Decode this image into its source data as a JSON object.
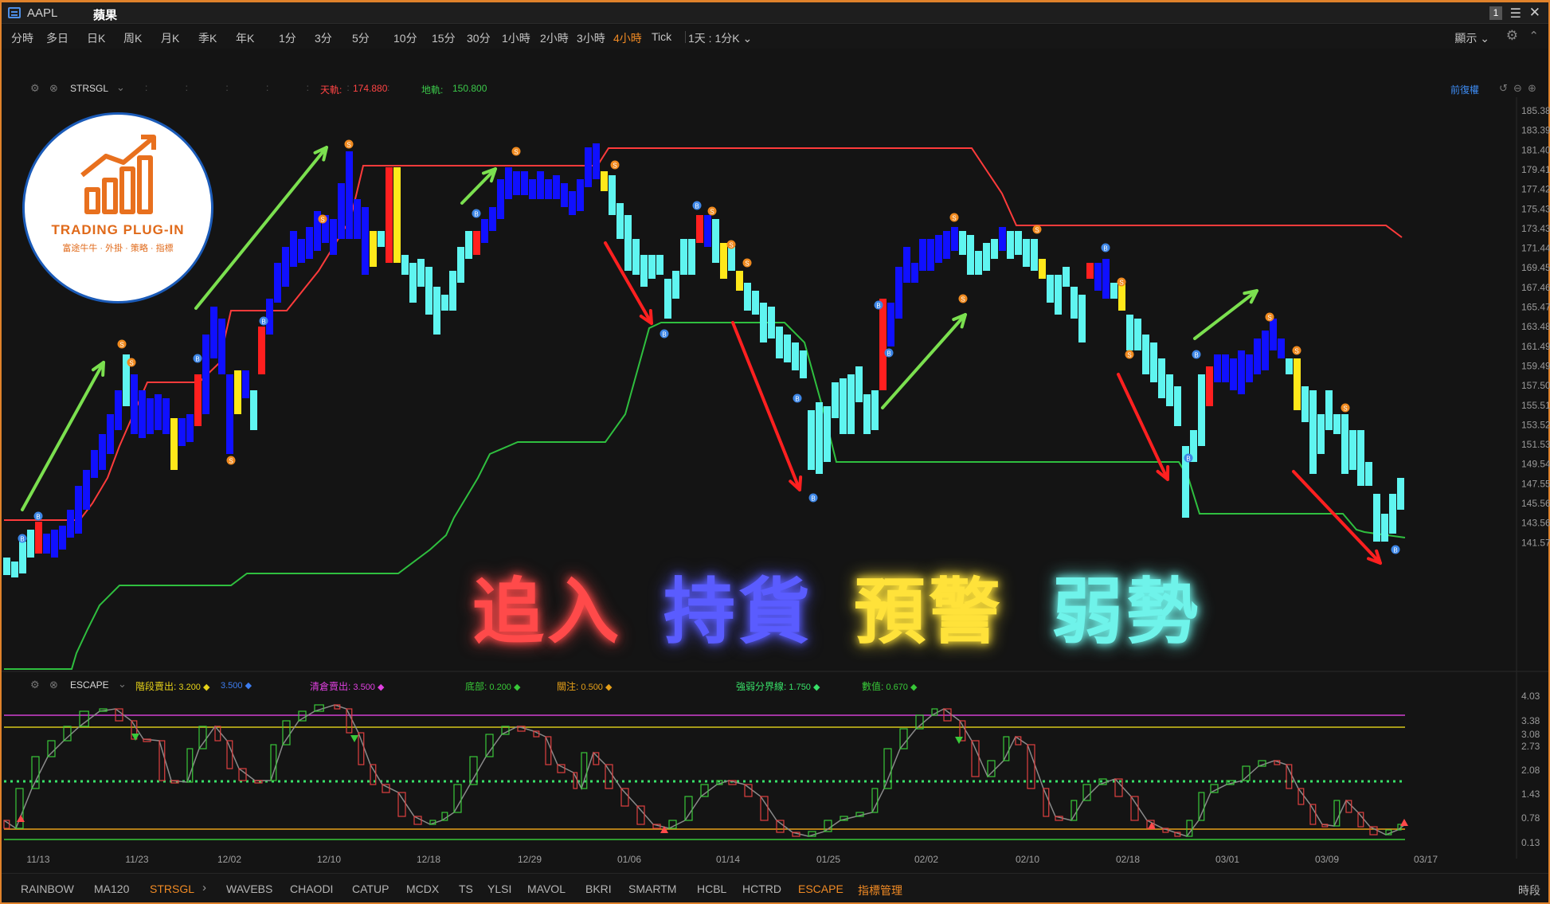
{
  "window": {
    "symbol": "AAPL",
    "name": "蘋果",
    "window_number": "1"
  },
  "periods": {
    "items": [
      "分時",
      "多日",
      "日K",
      "周K",
      "月K",
      "季K",
      "年K",
      "1分",
      "3分",
      "5分",
      "10分",
      "15分",
      "30分",
      "1小時",
      "2小時",
      "3小時",
      "4小時",
      "Tick"
    ],
    "active": "4小時",
    "aggregation": "1天 : 1分K",
    "display_label": "顯示"
  },
  "strsgl": {
    "name": "STRSGL",
    "upper_label": "天軌:",
    "upper_value": "174.880",
    "lower_label": "地軌:",
    "lower_value": "150.800",
    "adjust_label": "前復權",
    "y_ticks": [
      "185.386",
      "183.395",
      "181.404",
      "179.412",
      "177.421",
      "175.430",
      "173.438",
      "171.447",
      "169.456",
      "167.464",
      "165.473",
      "163.482",
      "161.490",
      "159.499",
      "157.508",
      "155.516",
      "153.525",
      "151.534",
      "149.542",
      "147.551",
      "145.560",
      "143.568",
      "141.577"
    ],
    "colors": {
      "upper": "#ff3b3b",
      "lower": "#2fbf3f",
      "chase": "#ff1f1f",
      "hold": "#1010ff",
      "warn": "#ffe81a",
      "weak": "#5ff5f0"
    }
  },
  "escape": {
    "name": "ESCAPE",
    "params": [
      {
        "label": "階段賣出:",
        "value": "3.200",
        "color": "#e6d219"
      },
      {
        "label": "",
        "value": "3.500",
        "color": "#3d7df0"
      },
      {
        "label": "清倉賣出:",
        "value": "3.500",
        "color": "#e040e0"
      },
      {
        "label": "底部:",
        "value": "0.200",
        "color": "#38c838"
      },
      {
        "label": "關注:",
        "value": "0.500",
        "color": "#e6a019"
      },
      {
        "label": "強弱分界線:",
        "value": "1.750",
        "color": "#38e068"
      },
      {
        "label": "數值:",
        "value": "0.670",
        "color": "#38c838"
      }
    ],
    "y_ticks": [
      "4.03",
      "3.38",
      "3.08",
      "2.73",
      "2.08",
      "1.43",
      "0.78",
      "0.13"
    ]
  },
  "dates": [
    "11/13",
    "11/23",
    "12/02",
    "12/10",
    "12/18",
    "12/29",
    "01/06",
    "01/14",
    "01/25",
    "02/02",
    "02/10",
    "02/18",
    "03/01",
    "03/09",
    "03/17"
  ],
  "logo": {
    "title": "TRADING PLUG-IN",
    "subtitle": "富途牛牛 · 外掛 · 策略 · 指標"
  },
  "legend": [
    {
      "text": "追入",
      "color": "#ff4a4a"
    },
    {
      "text": "持貨",
      "color": "#5a5cff"
    },
    {
      "text": "預警",
      "color": "#ffe23a"
    },
    {
      "text": "弱勢",
      "color": "#6ff3ea"
    }
  ],
  "signals": {
    "buy": "B",
    "sell": "S"
  },
  "bottom_tabs": {
    "items": [
      "RAINBOW",
      "MA120",
      "STRSGL",
      "WAVEBS",
      "CHAODI",
      "CATUP",
      "MCDX",
      "TS",
      "YLSI",
      "MAVOL",
      "BKRI",
      "SMARTM",
      "HCBL",
      "HCTRD",
      "ESCAPE"
    ],
    "active": [
      "STRSGL",
      "ESCAPE"
    ],
    "manager": "指標管理",
    "time_segment": "時段"
  }
}
